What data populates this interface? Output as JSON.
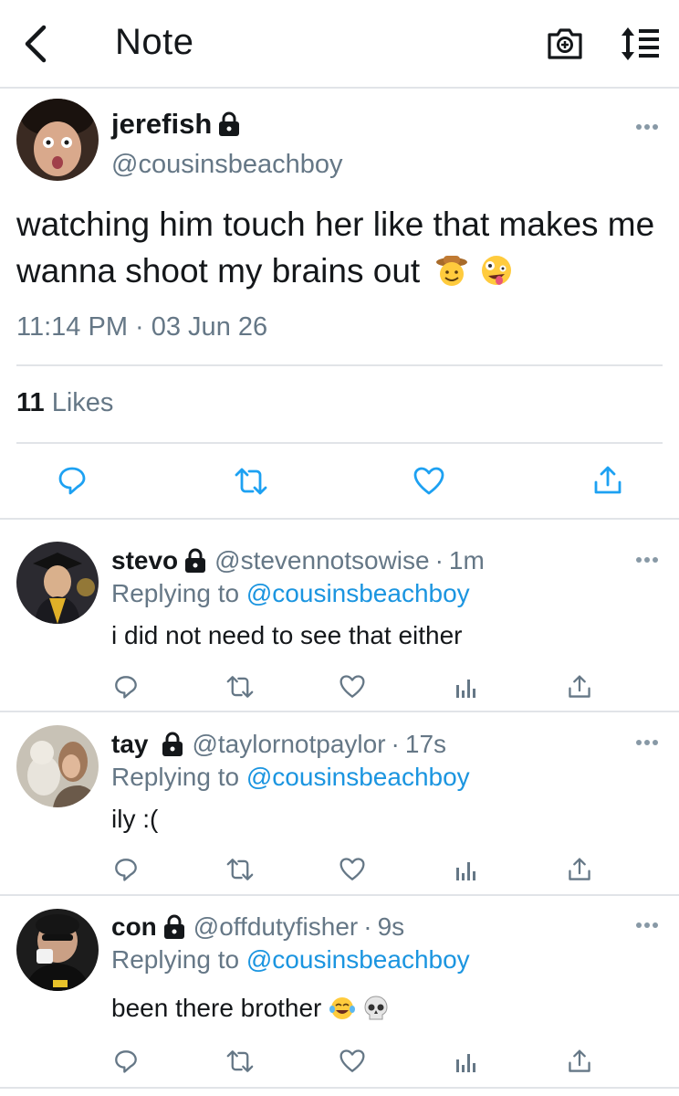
{
  "header": {
    "title": "Note"
  },
  "tweet": {
    "name": "jerefish",
    "handle": "@cousinsbeachboy",
    "text": "watching him touch her like that makes me wanna shoot my brains out",
    "emoji": [
      "cowboy-face",
      "zany-face"
    ],
    "timestamp": "11:14 PM · 03 Jun 26",
    "likes_count": "11",
    "likes_label": "Likes"
  },
  "replies": [
    {
      "name": "stevo",
      "handle": "@stevennotsowise",
      "time": "1m",
      "replying_label": "Replying to",
      "replying_to": "@cousinsbeachboy",
      "text": "i did not need to see that either"
    },
    {
      "name": "tay",
      "handle": "@taylornotpaylor",
      "time": "17s",
      "replying_label": "Replying to",
      "replying_to": "@cousinsbeachboy",
      "text": "ily :("
    },
    {
      "name": "con",
      "handle": "@offdutyfisher",
      "time": "9s",
      "replying_label": "Replying to",
      "replying_to": "@cousinsbeachboy",
      "text": "been there brother",
      "emoji": [
        "tears-of-joy",
        "skull"
      ]
    }
  ],
  "colors": {
    "link": "#1b95e0",
    "secondary": "#657786",
    "divider": "#e1e4e8",
    "icon": "#1da1f2"
  }
}
